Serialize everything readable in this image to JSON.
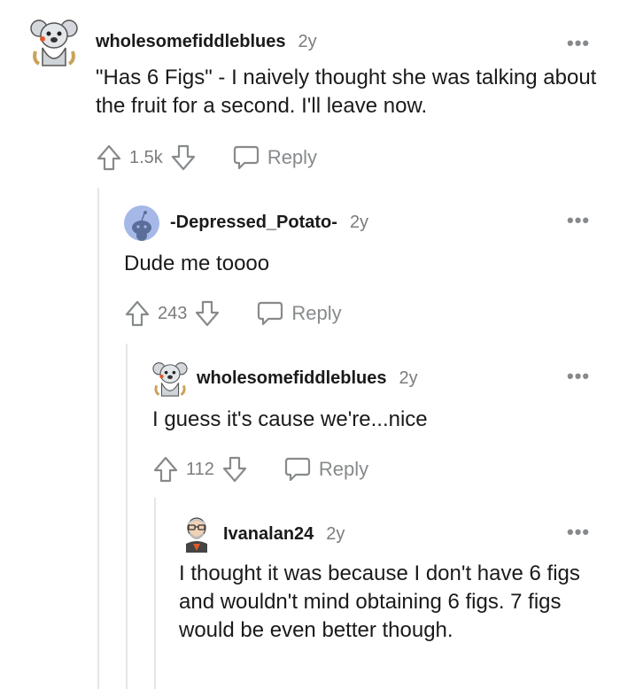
{
  "comments": [
    {
      "username": "wholesomefiddleblues",
      "age": "2y",
      "text": "\"Has 6 Figs\" - I naively thought she was talking about the fruit for a second. I'll leave now.",
      "votes": "1.5k",
      "reply_label": "Reply"
    },
    {
      "username": "-Depressed_Potato-",
      "age": "2y",
      "text": "Dude me toooo",
      "votes": "243",
      "reply_label": "Reply"
    },
    {
      "username": "wholesomefiddleblues",
      "age": "2y",
      "text": "I guess it's cause we're...nice",
      "votes": "112",
      "reply_label": "Reply"
    },
    {
      "username": "Ivanalan24",
      "age": "2y",
      "text": "I thought it was because I don't have 6 figs and wouldn't mind obtaining 6 figs. 7 figs would be even better though."
    }
  ],
  "more_label": "•••",
  "colors": {
    "meta_gray": "#7c7c7c",
    "icon_gray": "#878a8c",
    "thread_line": "#e6e6e6",
    "avatar_blue": "#a5b8e8"
  }
}
